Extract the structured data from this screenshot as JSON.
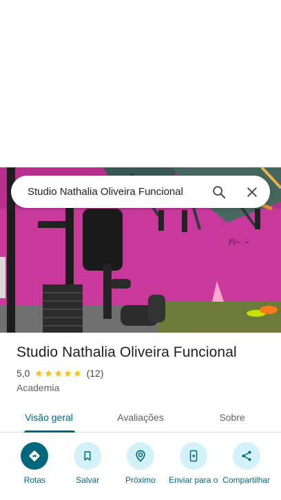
{
  "search": {
    "query": "Studio Nathalia Oliveira Funcional"
  },
  "place": {
    "name": "Studio Nathalia Oliveira Funcional",
    "rating": "5,0",
    "stars": 5,
    "review_count": "(12)",
    "category": "Academia"
  },
  "tabs": [
    {
      "label": "Visão geral",
      "active": true
    },
    {
      "label": "Avaliações",
      "active": false
    },
    {
      "label": "Sobre",
      "active": false
    }
  ],
  "actions": [
    {
      "label": "Rotas",
      "icon": "directions-icon"
    },
    {
      "label": "Salvar",
      "icon": "bookmark-icon"
    },
    {
      "label": "Próximo",
      "icon": "nearby-icon"
    },
    {
      "label": "Enviar para o",
      "icon": "send-to-phone-icon"
    },
    {
      "label": "Compartilhar",
      "icon": "share-icon"
    }
  ],
  "colors": {
    "accent": "#00677d",
    "action_bg": "#d2f1f9",
    "star": "#fbbc04",
    "wall": "#c83aa0"
  }
}
